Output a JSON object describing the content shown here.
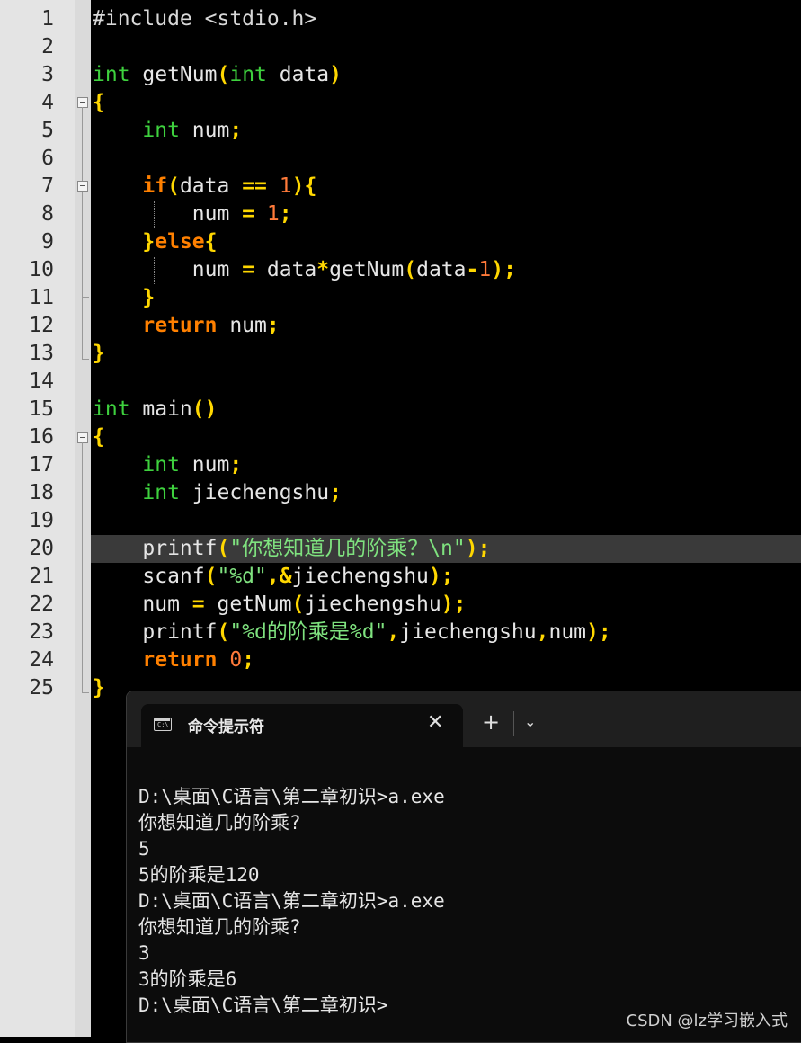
{
  "editor": {
    "lines": [
      {
        "n": "1",
        "t": [
          [
            "pre",
            "#include <stdio.h>"
          ]
        ]
      },
      {
        "n": "2",
        "t": []
      },
      {
        "n": "3",
        "t": [
          [
            "ty",
            "int"
          ],
          [
            "fn",
            " getNum"
          ],
          [
            "op",
            "("
          ],
          [
            "ty",
            "int"
          ],
          [
            "fn",
            " data"
          ],
          [
            "op",
            ")"
          ]
        ]
      },
      {
        "n": "4",
        "t": [
          [
            "op",
            "{"
          ]
        ]
      },
      {
        "n": "5",
        "t": [
          [
            "fn",
            "    "
          ],
          [
            "ty",
            "int"
          ],
          [
            "fn",
            " num"
          ],
          [
            "op",
            ";"
          ]
        ]
      },
      {
        "n": "6",
        "t": []
      },
      {
        "n": "7",
        "t": [
          [
            "fn",
            "    "
          ],
          [
            "kw",
            "if"
          ],
          [
            "op",
            "("
          ],
          [
            "fn",
            "data "
          ],
          [
            "op",
            "=="
          ],
          [
            "fn",
            " "
          ],
          [
            "num",
            "1"
          ],
          [
            "op",
            ")"
          ],
          [
            "op",
            "{"
          ]
        ]
      },
      {
        "n": "8",
        "t": [
          [
            "fn",
            "        num "
          ],
          [
            "op",
            "="
          ],
          [
            "fn",
            " "
          ],
          [
            "num",
            "1"
          ],
          [
            "op",
            ";"
          ]
        ]
      },
      {
        "n": "9",
        "t": [
          [
            "fn",
            "    "
          ],
          [
            "op",
            "}"
          ],
          [
            "kw",
            "else"
          ],
          [
            "op",
            "{"
          ]
        ]
      },
      {
        "n": "10",
        "t": [
          [
            "fn",
            "        num "
          ],
          [
            "op",
            "="
          ],
          [
            "fn",
            " data"
          ],
          [
            "op",
            "*"
          ],
          [
            "fn",
            "getNum"
          ],
          [
            "op",
            "("
          ],
          [
            "fn",
            "data"
          ],
          [
            "op",
            "-"
          ],
          [
            "num",
            "1"
          ],
          [
            "op",
            ")"
          ],
          [
            "op",
            ";"
          ]
        ]
      },
      {
        "n": "11",
        "t": [
          [
            "fn",
            "    "
          ],
          [
            "op",
            "}"
          ]
        ]
      },
      {
        "n": "12",
        "t": [
          [
            "fn",
            "    "
          ],
          [
            "kw",
            "return"
          ],
          [
            "fn",
            " num"
          ],
          [
            "op",
            ";"
          ]
        ]
      },
      {
        "n": "13",
        "t": [
          [
            "op",
            "}"
          ]
        ]
      },
      {
        "n": "14",
        "t": []
      },
      {
        "n": "15",
        "t": [
          [
            "ty",
            "int"
          ],
          [
            "fn",
            " main"
          ],
          [
            "op",
            "()"
          ]
        ]
      },
      {
        "n": "16",
        "t": [
          [
            "op",
            "{"
          ]
        ]
      },
      {
        "n": "17",
        "t": [
          [
            "fn",
            "    "
          ],
          [
            "ty",
            "int"
          ],
          [
            "fn",
            " num"
          ],
          [
            "op",
            ";"
          ]
        ]
      },
      {
        "n": "18",
        "t": [
          [
            "fn",
            "    "
          ],
          [
            "ty",
            "int"
          ],
          [
            "fn",
            " jiechengshu"
          ],
          [
            "op",
            ";"
          ]
        ]
      },
      {
        "n": "19",
        "t": []
      },
      {
        "n": "20",
        "t": [
          [
            "fn",
            "    printf"
          ],
          [
            "op",
            "("
          ],
          [
            "str",
            "\"你想知道几的阶乘？\\n\""
          ],
          [
            "op",
            ")"
          ],
          [
            "op",
            ";"
          ]
        ]
      },
      {
        "n": "21",
        "t": [
          [
            "fn",
            "    scanf"
          ],
          [
            "op",
            "("
          ],
          [
            "str",
            "\"%d\""
          ],
          [
            "op",
            ",&"
          ],
          [
            "fn",
            "jiechengshu"
          ],
          [
            "op",
            ")"
          ],
          [
            "op",
            ";"
          ]
        ]
      },
      {
        "n": "22",
        "t": [
          [
            "fn",
            "    num "
          ],
          [
            "op",
            "="
          ],
          [
            "fn",
            " getNum"
          ],
          [
            "op",
            "("
          ],
          [
            "fn",
            "jiechengshu"
          ],
          [
            "op",
            ")"
          ],
          [
            "op",
            ";"
          ]
        ]
      },
      {
        "n": "23",
        "t": [
          [
            "fn",
            "    printf"
          ],
          [
            "op",
            "("
          ],
          [
            "str",
            "\"%d的阶乘是%d\""
          ],
          [
            "op",
            ","
          ],
          [
            "fn",
            "jiechengshu"
          ],
          [
            "op",
            ","
          ],
          [
            "fn",
            "num"
          ],
          [
            "op",
            ")"
          ],
          [
            "op",
            ";"
          ]
        ]
      },
      {
        "n": "24",
        "t": [
          [
            "fn",
            "    "
          ],
          [
            "kw",
            "return"
          ],
          [
            "fn",
            " "
          ],
          [
            "num",
            "0"
          ],
          [
            "op",
            ";"
          ]
        ]
      },
      {
        "n": "25",
        "t": [
          [
            "op",
            "}"
          ]
        ]
      }
    ]
  },
  "terminal": {
    "tab_title": "命令提示符",
    "icon_text": "C:\\",
    "close_label": "✕",
    "new_tab_label": "+",
    "dropdown_label": "⌄",
    "output": [
      "D:\\桌面\\C语言\\第二章初识>a.exe",
      "你想知道几的阶乘?",
      "5",
      "5的阶乘是120",
      "D:\\桌面\\C语言\\第二章初识>a.exe",
      "你想知道几的阶乘?",
      "3",
      "3的阶乘是6",
      "D:\\桌面\\C语言\\第二章初识>"
    ]
  },
  "watermark": "CSDN @lz学习嵌入式",
  "colors": {
    "keyword": "#ff8000",
    "type": "#3ed13e",
    "operator": "#ffd700",
    "number": "#ff7a3a",
    "string": "#7fe27f"
  }
}
